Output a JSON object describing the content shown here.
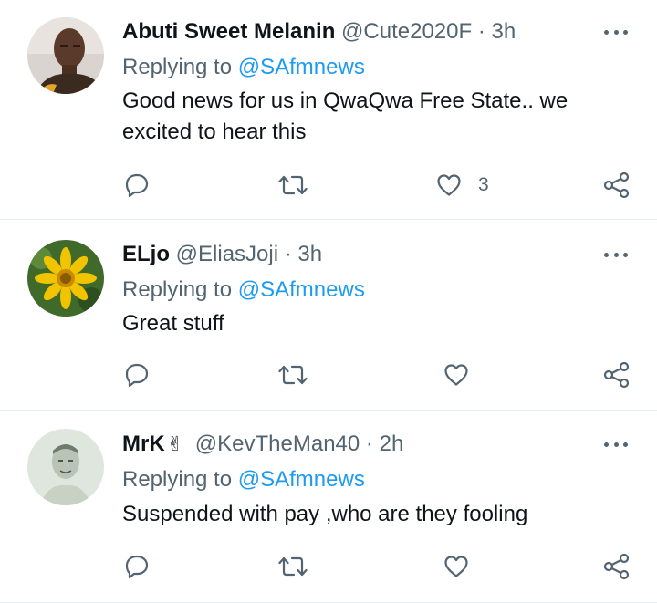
{
  "tweets": [
    {
      "name": "Abuti Sweet Melanin",
      "handle": "@Cute2020F",
      "separator": "·",
      "time": "3h",
      "replying_prefix": "Replying to",
      "replying_to": "@SAfmnews",
      "text": "Good news for us in QwaQwa Free State.. we excited to hear this",
      "like_count": "3",
      "avatar_icon": "profile-photo-man"
    },
    {
      "name": "ELjo",
      "handle": "@EliasJoji",
      "separator": "·",
      "time": "3h",
      "replying_prefix": "Replying to",
      "replying_to": "@SAfmnews",
      "text": "Great stuff",
      "like_count": "",
      "avatar_icon": "profile-photo-flower"
    },
    {
      "name": "MrK",
      "name_emoji": "✌",
      "handle": "@KevTheMan40",
      "separator": "·",
      "time": "2h",
      "replying_prefix": "Replying to",
      "replying_to": "@SAfmnews",
      "text": "Suspended with pay ,who are they fooling",
      "like_count": "",
      "avatar_icon": "profile-photo-man-sketch"
    }
  ],
  "icons": {
    "reply": "reply-icon",
    "retweet": "retweet-icon",
    "like": "like-icon",
    "share": "share-icon",
    "more": "more-icon"
  },
  "colors": {
    "text": "#0f1419",
    "secondary": "#536471",
    "link": "#1d9bf0",
    "divider": "#e6ecf0"
  }
}
